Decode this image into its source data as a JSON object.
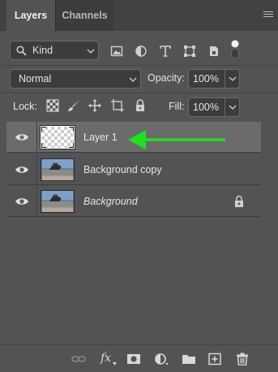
{
  "tabs": [
    {
      "label": "Layers",
      "active": true
    },
    {
      "label": "Channels",
      "active": false
    }
  ],
  "filter": {
    "kind_label": "Kind",
    "icons": [
      "image-filter-icon",
      "adjustment-filter-icon",
      "type-filter-icon",
      "shape-filter-icon",
      "smart-object-filter-icon",
      "filter-toggle-icon"
    ]
  },
  "blend": {
    "mode": "Normal",
    "opacity_label": "Opacity:",
    "opacity_value": "100%"
  },
  "lock": {
    "label": "Lock:",
    "icons": [
      "lock-transparent-pixels-icon",
      "lock-image-pixels-icon",
      "lock-position-icon",
      "lock-artboard-icon",
      "lock-all-icon"
    ],
    "fill_label": "Fill:",
    "fill_value": "100%"
  },
  "layers": [
    {
      "name": "Layer 1",
      "selected": true,
      "italic": false,
      "locked": false,
      "thumbnail": "transparent"
    },
    {
      "name": "Background copy",
      "selected": false,
      "italic": false,
      "locked": false,
      "thumbnail": "photo"
    },
    {
      "name": "Background",
      "selected": false,
      "italic": true,
      "locked": true,
      "thumbnail": "photo"
    }
  ],
  "annotation": {
    "type": "arrow",
    "color": "#1fe01f",
    "points_to": "Layer 1"
  },
  "bottom_bar": [
    "link-layers-icon",
    "fx-icon",
    "add-mask-icon",
    "adjustment-layer-icon",
    "group-folder-icon",
    "new-layer-icon",
    "delete-icon"
  ],
  "colors": {
    "panel": "#535353",
    "tabbar": "#424242",
    "selected_row": "#6b6b6b",
    "field": "#3c3c3c"
  }
}
